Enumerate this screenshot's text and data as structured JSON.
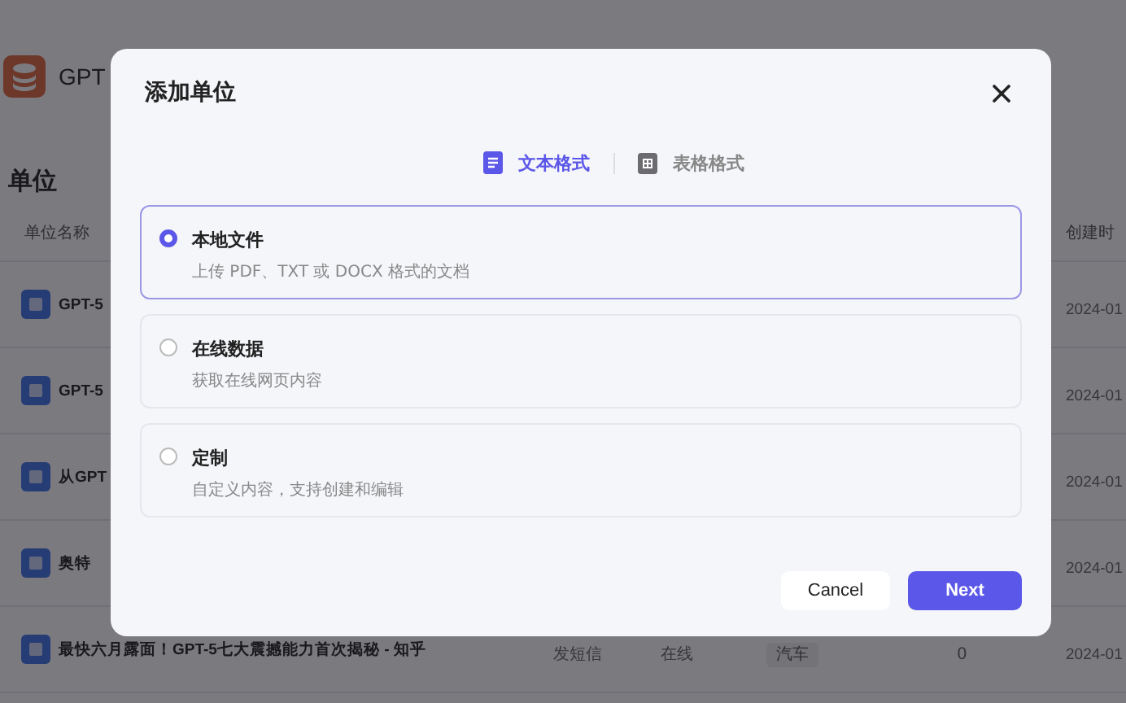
{
  "page": {
    "title": "GPT",
    "section_title": "单位",
    "table": {
      "columns": [
        "单位名称",
        "创建时"
      ],
      "rows": [
        {
          "name": "GPT-5",
          "created": "2024-01"
        },
        {
          "name": "GPT-5",
          "created": "2024-01"
        },
        {
          "name": "从GPT",
          "created": "2024-01"
        },
        {
          "name": "奥特",
          "created": "2024-01"
        },
        {
          "name": "最快六月露面！GPT-5七大震撼能力首次揭秘 - 知乎",
          "sender": "发短信",
          "status": "在线",
          "tag": "汽车",
          "count": "0",
          "created": "2024-01"
        }
      ]
    }
  },
  "dialog": {
    "title": "添加单位",
    "tabs": [
      {
        "label": "文本格式",
        "kind": "text",
        "selected": true
      },
      {
        "label": "表格格式",
        "kind": "table",
        "selected": false
      }
    ],
    "options": [
      {
        "title": "本地文件",
        "description": "上传 PDF、TXT 或 DOCX 格式的文档",
        "selected": true
      },
      {
        "title": "在线数据",
        "description": "获取在线网页内容",
        "selected": false
      },
      {
        "title": "定制",
        "description": "自定义内容，支持创建和编辑",
        "selected": false
      }
    ],
    "buttons": [
      {
        "label": "Cancel",
        "kind": "secondary"
      },
      {
        "label": "Next",
        "kind": "primary"
      }
    ]
  }
}
